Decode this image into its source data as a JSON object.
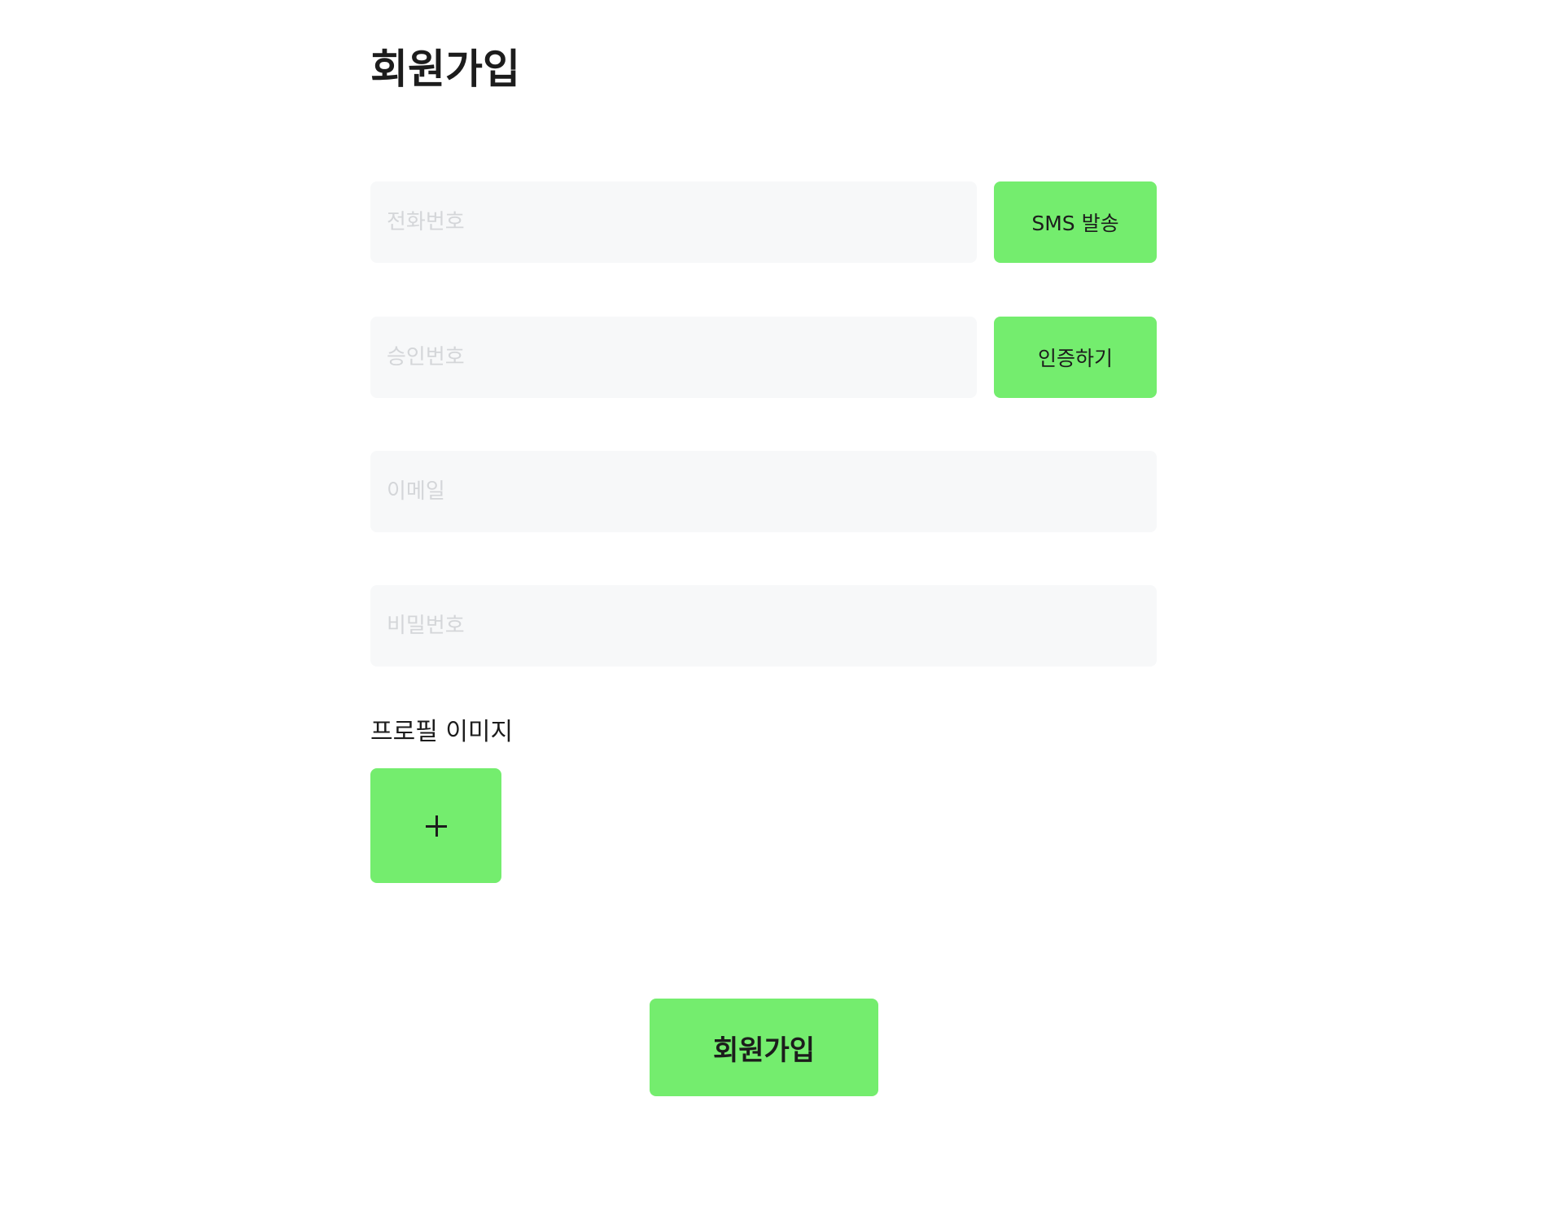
{
  "page": {
    "title": "회원가입"
  },
  "form": {
    "phone": {
      "placeholder": "전화번호",
      "value": ""
    },
    "sms_button_label": "SMS 발송",
    "auth_code": {
      "placeholder": "승인번호",
      "value": ""
    },
    "verify_button_label": "인증하기",
    "email": {
      "placeholder": "이메일",
      "value": ""
    },
    "password": {
      "placeholder": "비밀번호",
      "value": ""
    },
    "profile_image": {
      "label": "프로필 이미지",
      "add_icon": "plus-icon"
    },
    "submit_label": "회원가입"
  },
  "colors": {
    "accent": "#74ed6e",
    "input_background": "#f7f8f9",
    "placeholder": "#d4d6d9",
    "text": "#1c1c1c"
  }
}
